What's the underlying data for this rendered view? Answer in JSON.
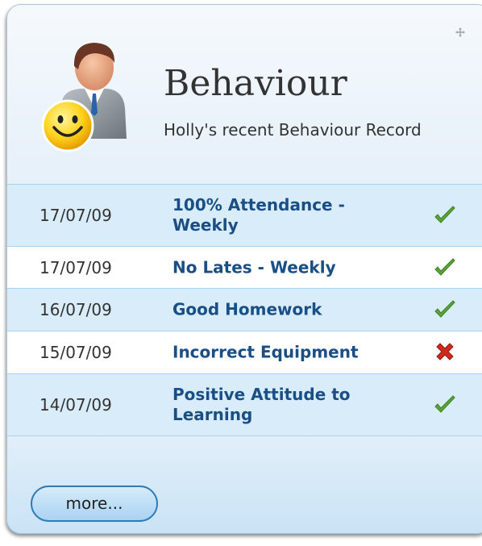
{
  "widget": {
    "title": "Behaviour",
    "subtitle": "Holly's recent Behaviour Record",
    "more_label": "more...",
    "icons": {
      "move": "move-icon",
      "avatar": "user-with-smiley-icon"
    }
  },
  "records": [
    {
      "date": "17/07/09",
      "name": "100% Attendance - Weekly",
      "status": "positive",
      "icon": "checkmark-icon"
    },
    {
      "date": "17/07/09",
      "name": "No Lates - Weekly",
      "status": "positive",
      "icon": "checkmark-icon"
    },
    {
      "date": "16/07/09",
      "name": "Good Homework",
      "status": "positive",
      "icon": "checkmark-icon"
    },
    {
      "date": "15/07/09",
      "name": "Incorrect Equipment",
      "status": "negative",
      "icon": "cross-icon"
    },
    {
      "date": "14/07/09",
      "name": "Positive Attitude to Learning",
      "status": "positive",
      "icon": "checkmark-icon"
    }
  ],
  "colors": {
    "positive": "#5aa53a",
    "negative": "#cc2a1e",
    "link": "#1a4f86",
    "row_alt": "#d8ecf9"
  }
}
